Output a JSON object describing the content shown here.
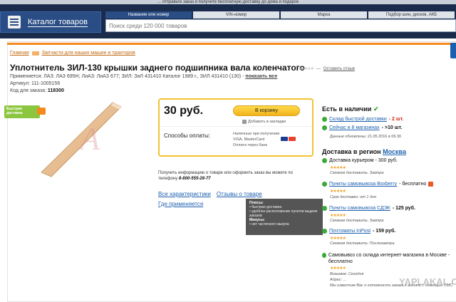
{
  "header": {
    "promo": "... отправьте заказ и получите бесплатную доставку до дома и подарок",
    "catalog_label": "Каталог товаров",
    "search_tabs": [
      "Название или номер",
      "VIN-номер",
      "Марка",
      "Подбор шин, дисков, АКБ"
    ],
    "search_placeholder": "Поиск среди 120 000 товаров"
  },
  "breadcrumb": [
    "Главная",
    "Запчасти для наших машин и тракторов"
  ],
  "product": {
    "title": "Уплотнитель ЗИЛ-130 крышки заднего подшипника вала коленчатого",
    "rating_stars": "★★★★★",
    "leave_review": "Оставить отзыв",
    "applies_label": "Применяется:",
    "applies_values": "ЛАЗ: ЛАЗ 695Н; ЛиАЗ: ЛиАЗ 677; ЗИЛ: ЗиЛ 431410 Каталог 1989 г., ЗИЛ 431410 (130) -",
    "show_all": "показать все",
    "article": "Артикул: 111-1005156",
    "order_code_label": "Код для заказа:",
    "order_code": "118300",
    "fast_badge": "Быстрая доставка"
  },
  "buy": {
    "price": "30 руб.",
    "cart_button": "В корзину",
    "bookmark": "Добавить в закладки",
    "payment_label": "Способы оплаты:",
    "payment_methods": [
      "Наличные при получении",
      "VISA, MasterCard",
      "Оплата через банк"
    ],
    "help_text": "Получить информацию о товаре или оформить заказ вы можете по телефону",
    "phone": "8-800-555-28-77"
  },
  "tabs": {
    "characteristics": "Все характеристики",
    "reviews": "Отзывы о товаре",
    "where_used": "Где применяется"
  },
  "tooltip": {
    "plus_title": "Плюсы:",
    "plus_1": "• быстрая доставка",
    "plus_2": "• удобное расположение пунктов выдачи заказов",
    "minus_title": "Минусы:",
    "minus_1": "• нет частичного выкупа"
  },
  "availability": {
    "heading": "Есть в наличии",
    "fast_warehouse": "Склад быстрой доставки",
    "fast_qty": "- 2 шт.",
    "stores": "Сейчас в 8 магазинах",
    "stores_qty": "- >10 шт.",
    "updated": "Данные обновлены: 21.05.2016 в 09.30"
  },
  "delivery": {
    "heading": "Доставка в регион",
    "region": "Москва",
    "courier": "Доставка курьером - 300 руб.",
    "courier_note": "Сможем доставить: Завтра",
    "boxberry": "Пункты самовывоза Boxberry",
    "boxberry_price": "- бесплатно",
    "boxberry_note": "Срок доставки: от 1 дня",
    "cdek": "Пункты самовывоза СДЭК",
    "cdek_price": "- 125 руб.",
    "cdek_note": "Сможем доставить: Завтра",
    "inpost": "Почтоматы InPost",
    "inpost_price": "- 159 руб.",
    "inpost_note": "Сможем доставить: Послезавтра",
    "pickup": "Самовывоз со склада интернет-магазина в Москве - бесплатно",
    "pickup_note_1": "Возьмем: Сегодня",
    "pickup_note_2": "Адрес: ...",
    "pickup_note_3": "Мы известим Вас о готовности заказа к выдаче с помощью СМС."
  },
  "watermark": "YAPLAKAL.COM"
}
